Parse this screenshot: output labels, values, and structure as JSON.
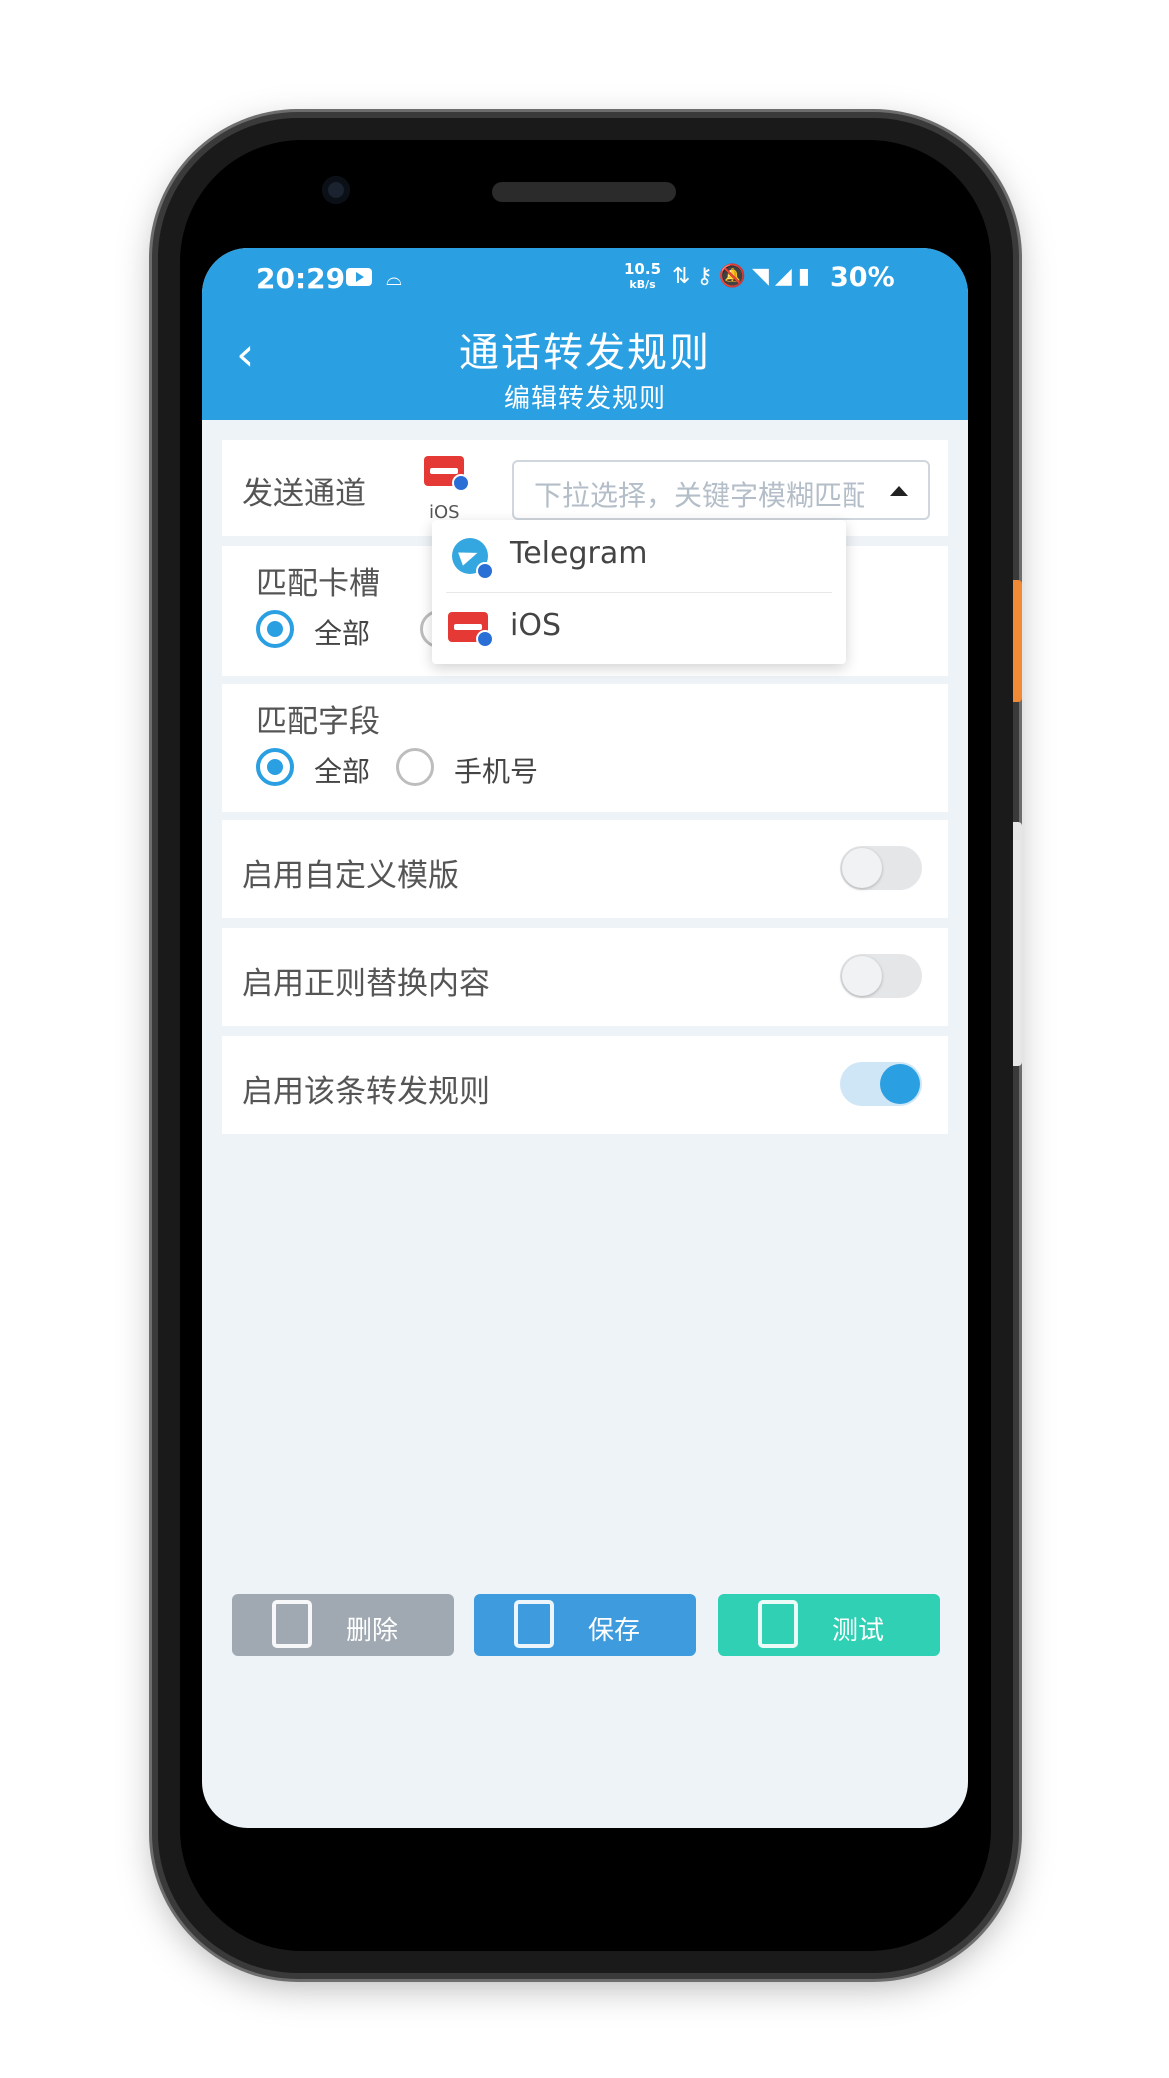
{
  "status_bar": {
    "time": "20:29",
    "net_speed": "10.5",
    "net_unit": "kB/s",
    "battery": "30%"
  },
  "header": {
    "title": "通话转发规则",
    "subtitle": "编辑转发规则"
  },
  "channel": {
    "label": "发送通道",
    "selected_caption": "iOS",
    "select_placeholder": "下拉选择，关键字模糊匹配"
  },
  "dropdown": {
    "options": [
      "Telegram",
      "iOS"
    ]
  },
  "sim_slot": {
    "label": "匹配卡槽",
    "options": [
      "全部"
    ]
  },
  "match_field": {
    "label": "匹配字段",
    "options": [
      "全部",
      "手机号"
    ]
  },
  "toggles": [
    {
      "label": "启用自定义模版",
      "on": false
    },
    {
      "label": "启用正则替换内容",
      "on": false
    },
    {
      "label": "启用该条转发规则",
      "on": true
    }
  ],
  "buttons": {
    "delete": "删除",
    "save": "保存",
    "test": "测试"
  },
  "colors": {
    "accent": "#2a9fe2",
    "delete_btn": "#a0a8b2",
    "save_btn": "#3d9bde",
    "test_btn": "#2fd0b4"
  }
}
